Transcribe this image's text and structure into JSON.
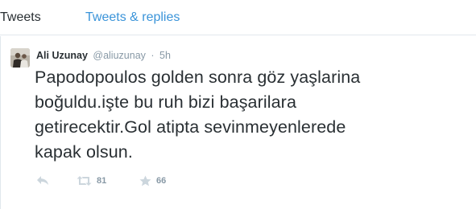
{
  "tabs": [
    {
      "label": "Tweets",
      "active": true
    },
    {
      "label": "Tweets & replies",
      "active": false
    }
  ],
  "tweet": {
    "fullname": "Ali Uzunay",
    "username": "@aliuzunay",
    "separator": "·",
    "time": "5h",
    "lines": [
      "Papodopoulos golden sonra göz yaşlarina",
      "boğuldu.işte bu ruh bizi başarilara",
      "getirecektir.Gol atipta sevinmeyenlerede",
      "kapak olsun."
    ],
    "actions": {
      "reply_icon": "reply-icon",
      "retweet_icon": "retweet-icon",
      "retweet_count": "81",
      "favorite_icon": "star-icon",
      "favorite_count": "66"
    }
  },
  "colors": {
    "link": "#3b94d9",
    "text": "#292f33",
    "muted": "#8899a6",
    "border": "#e1e8ed",
    "icon": "#ccd6dd"
  }
}
